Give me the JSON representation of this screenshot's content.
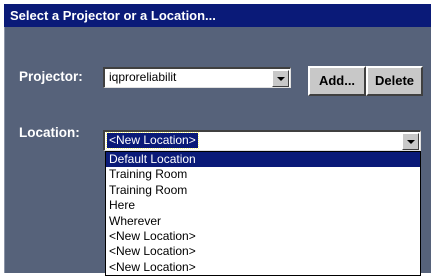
{
  "dialog": {
    "title": "Select a Projector or a Location..."
  },
  "projector": {
    "label": "Projector:",
    "value": "iqproreliabilit",
    "add_label": "Add...",
    "delete_label": "Delete"
  },
  "location": {
    "label": "Location:",
    "value": "<New Location>",
    "options": [
      "Default Location",
      "Training Room",
      "Training Room",
      "Here",
      "Wherever",
      "<New Location>",
      "<New Location>",
      "<New Location>"
    ],
    "highlighted_option": "Default Location"
  },
  "colors": {
    "title_bar": "#0a1a78",
    "dialog_background": "#56627a",
    "button_face": "#c8c8c8"
  }
}
